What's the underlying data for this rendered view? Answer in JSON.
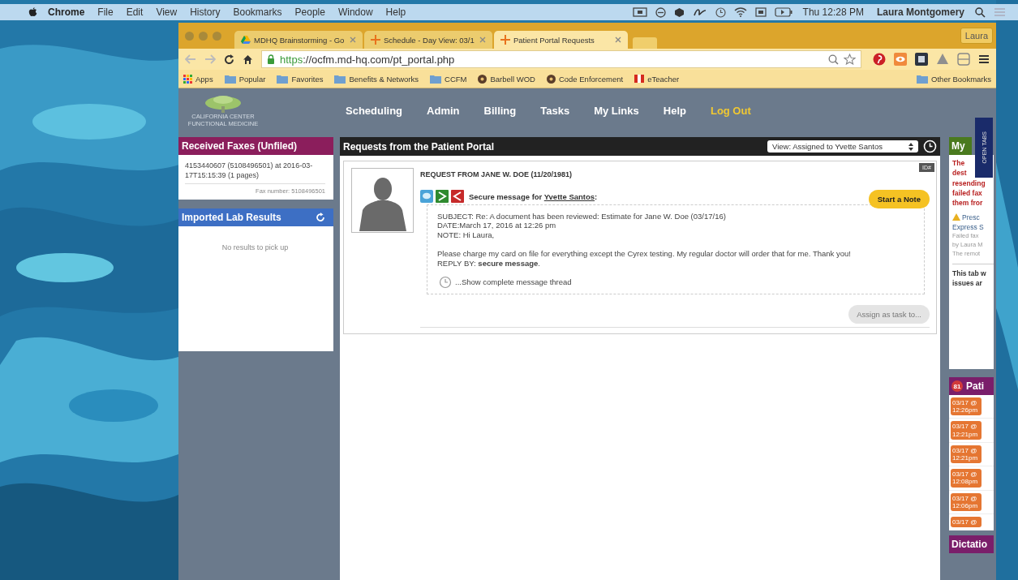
{
  "menubar": {
    "app": "Chrome",
    "menus": [
      "File",
      "Edit",
      "View",
      "History",
      "Bookmarks",
      "People",
      "Window",
      "Help"
    ],
    "clock": "Thu 12:28 PM",
    "user": "Laura Montgomery"
  },
  "browser": {
    "tabs": [
      {
        "title": "MDHQ Brainstorming - Go",
        "selected": false
      },
      {
        "title": "Schedule - Day View: 03/1",
        "selected": false
      },
      {
        "title": "Patient Portal Requests",
        "selected": true
      }
    ],
    "profile": "Laura",
    "url_scheme": "https",
    "url_rest": "://ocfm.md-hq.com/pt_portal.php",
    "bookmarks": [
      {
        "label": "Apps",
        "kind": "apps"
      },
      {
        "label": "Popular",
        "kind": "folder"
      },
      {
        "label": "Favorites",
        "kind": "folder"
      },
      {
        "label": "Benefits & Networks",
        "kind": "folder"
      },
      {
        "label": "CCFM",
        "kind": "folder"
      },
      {
        "label": "Barbell WOD",
        "kind": "site"
      },
      {
        "label": "Code Enforcement",
        "kind": "site"
      },
      {
        "label": "eTeacher",
        "kind": "flag"
      }
    ],
    "other_bookmarks": "Other Bookmarks"
  },
  "site": {
    "logo": [
      "CALIFORNIA CENTER",
      "FUNCTIONAL MEDICINE"
    ],
    "nav": [
      {
        "label": "Scheduling",
        "kind": "link"
      },
      {
        "label": "Admin",
        "kind": "link"
      },
      {
        "label": "Billing",
        "kind": "link"
      },
      {
        "label": "Tasks",
        "kind": "link"
      },
      {
        "label": "My Links",
        "kind": "link"
      },
      {
        "label": "Help",
        "kind": "link"
      },
      {
        "label": "Log Out",
        "kind": "logout"
      }
    ]
  },
  "faxes": {
    "title": "Received Faxes (Unfiled)",
    "entry": "4153440607 (5108496501) at 2016-03-17T15:15:39 (1 pages)",
    "fax_number": "Fax number: 5108496501"
  },
  "lab_results": {
    "title": "Imported Lab Results",
    "empty": "No results to pick up"
  },
  "requests": {
    "title": "Requests from the Patient Portal",
    "view": "View: Assigned to Yvette Santos",
    "id_tag": "ID#",
    "heading": "REQUEST FROM JANE W. DOE (11/20/1981)",
    "message_for": "Secure message for",
    "recipient": "Yvette Santos",
    "recipient_suffix": ":",
    "subject": "SUBJECT: Re: A document has been reviewed: Estimate for Jane W. Doe (03/17/16)",
    "date": "DATE:March 17, 2016 at 12:26 pm",
    "note": "NOTE: Hi Laura,",
    "body": "Please charge my card on file for everything except the Cyrex testing. My regular doctor will order that for me. Thank you!",
    "reply_by": "REPLY BY: **secure message**.",
    "thread_link": "...Show complete message thread",
    "start_note": "Start a Note",
    "assign": "Assign as task to..."
  },
  "side": {
    "my_title": "My",
    "alert_lines": [
      "The",
      "dest",
      "resending",
      "failed fax",
      "them fror"
    ],
    "prescription_lines": [
      "Presc",
      "Express S"
    ],
    "detail_lines": [
      "Failed fax",
      "by Laura M",
      "The remot"
    ],
    "info_lines": [
      "This tab w",
      "issues ar"
    ],
    "open_tabs": "OPEN TABS",
    "patient_title": "Pati",
    "patient_count": "81",
    "patient_times": [
      {
        "date": "03/17 @",
        "time": "12:26pm"
      },
      {
        "date": "03/17 @",
        "time": "12:21pm"
      },
      {
        "date": "03/17 @",
        "time": "12:21pm"
      },
      {
        "date": "03/17 @",
        "time": "12:08pm"
      },
      {
        "date": "03/17 @",
        "time": "12:06pm"
      },
      {
        "date": "03/17 @"
      }
    ],
    "dictation_title": "Dictatio"
  }
}
